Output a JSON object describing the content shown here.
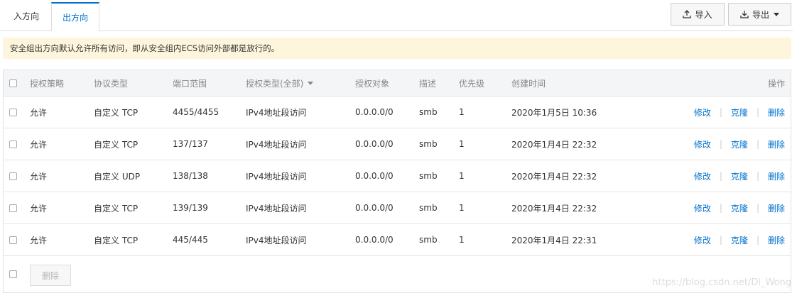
{
  "tabs": [
    {
      "label": "入方向",
      "active": false
    },
    {
      "label": "出方向",
      "active": true
    }
  ],
  "toolbar": {
    "import_label": "导入",
    "import_icon": "upload-icon",
    "export_label": "导出",
    "export_icon": "download-icon"
  },
  "notice": "安全组出方向默认允许所有访问，即从安全组内ECS访问外部都是放行的。",
  "table": {
    "headers": {
      "policy": "授权策略",
      "protocol": "协议类型",
      "port": "端口范围",
      "auth_type": "授权类型(全部)",
      "object": "授权对象",
      "desc": "描述",
      "priority": "优先级",
      "created": "创建时间",
      "actions": "操作"
    },
    "rows": [
      {
        "policy": "允许",
        "protocol": "自定义 TCP",
        "port": "4455/4455",
        "auth_type": "IPv4地址段访问",
        "object": "0.0.0.0/0",
        "desc": "smb",
        "priority": "1",
        "created": "2020年1月5日 10:36"
      },
      {
        "policy": "允许",
        "protocol": "自定义 TCP",
        "port": "137/137",
        "auth_type": "IPv4地址段访问",
        "object": "0.0.0.0/0",
        "desc": "smb",
        "priority": "1",
        "created": "2020年1月4日 22:32"
      },
      {
        "policy": "允许",
        "protocol": "自定义 UDP",
        "port": "138/138",
        "auth_type": "IPv4地址段访问",
        "object": "0.0.0.0/0",
        "desc": "smb",
        "priority": "1",
        "created": "2020年1月4日 22:32"
      },
      {
        "policy": "允许",
        "protocol": "自定义 TCP",
        "port": "139/139",
        "auth_type": "IPv4地址段访问",
        "object": "0.0.0.0/0",
        "desc": "smb",
        "priority": "1",
        "created": "2020年1月4日 22:32"
      },
      {
        "policy": "允许",
        "protocol": "自定义 TCP",
        "port": "445/445",
        "auth_type": "IPv4地址段访问",
        "object": "0.0.0.0/0",
        "desc": "smb",
        "priority": "1",
        "created": "2020年1月4日 22:31"
      }
    ],
    "row_actions": {
      "edit": "修改",
      "clone": "克隆",
      "delete": "删除",
      "separator": "|"
    },
    "footer": {
      "delete_label": "删除"
    }
  },
  "watermark": "https://blog.csdn.net/Di_Wong",
  "colors": {
    "accent": "#0070cc",
    "notice_bg": "#fdf6dc"
  }
}
